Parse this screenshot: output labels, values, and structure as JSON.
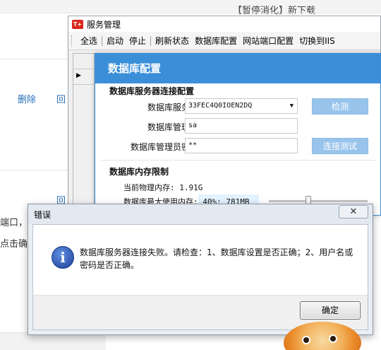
{
  "background_page": {
    "header_text": "【暂停消化】新下载",
    "delete_link": "删除",
    "link_fragment": "回",
    "text_line1": "端口，如",
    "text_line2": "点击确"
  },
  "service_window": {
    "title": "服务管理",
    "logo_text": "T+",
    "toolbar": {
      "select_all": "全选",
      "start": "启动",
      "stop": "停止",
      "refresh_status": "刷新状态",
      "db_config": "数据库配置",
      "site_port_config": "网站端口配置",
      "switch_to_iis": "切换到IIS"
    }
  },
  "db_dialog": {
    "title": "数据库配置",
    "section_connection": "数据库服务器连接配置",
    "server_label": "数据库服务器",
    "server_value": "33FEC4Q0IOEN2DQ",
    "admin_label": "数据库管理员",
    "admin_value": "sa",
    "password_label": "数据库管理员密码",
    "password_value": "**",
    "detect_button": "检测",
    "test_button": "连接测试",
    "section_memory": "数据库内存限制",
    "physical_memory": "当前物理内存: 1.91G",
    "max_memory": "数据库最大使用内存: 40%: 781MB",
    "memory_percent": 40
  },
  "error_dialog": {
    "title": "错误",
    "message": "数据库服务器连接失败。请检查：1、数据库设置是否正确；2、用户名或密码是否正确。",
    "ok_button": "确定",
    "close_glyph": "✕",
    "icon": "info-icon",
    "icon_glyph": "i"
  },
  "colors": {
    "dialog_header": "#3b8fd9",
    "button_disabled": "#98c4ec",
    "link": "#2a6fb8"
  }
}
